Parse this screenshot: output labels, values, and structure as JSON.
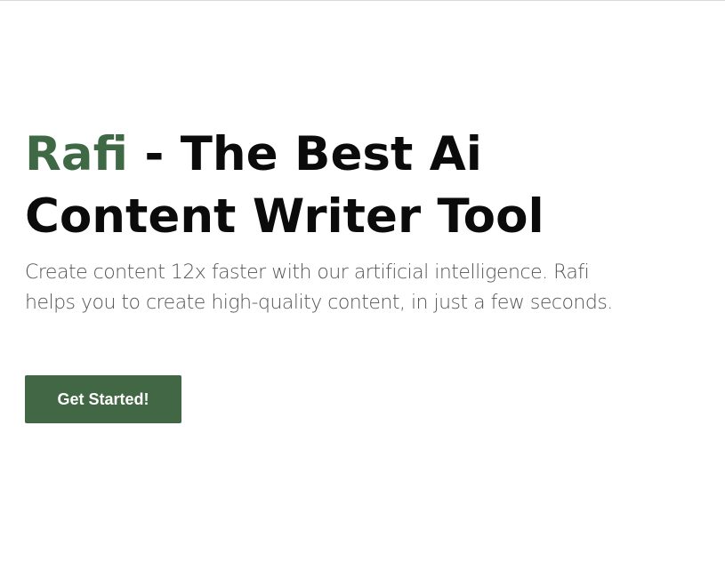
{
  "hero": {
    "title_brand": "Rafi",
    "title_rest_line1": " - The Best Ai",
    "title_line2": "Content Writer Tool",
    "subtitle_line1": "Create content 12x faster with our artificial intelligence. Rafi",
    "subtitle_line2": "helps you to create high-quality content, in just a few seconds.",
    "cta_label": "Get Started!"
  },
  "colors": {
    "brand_green": "#3f6945",
    "button_green": "#416744",
    "heading_text": "#0b0b0b",
    "body_text": "#555555",
    "background": "#ffffff"
  }
}
